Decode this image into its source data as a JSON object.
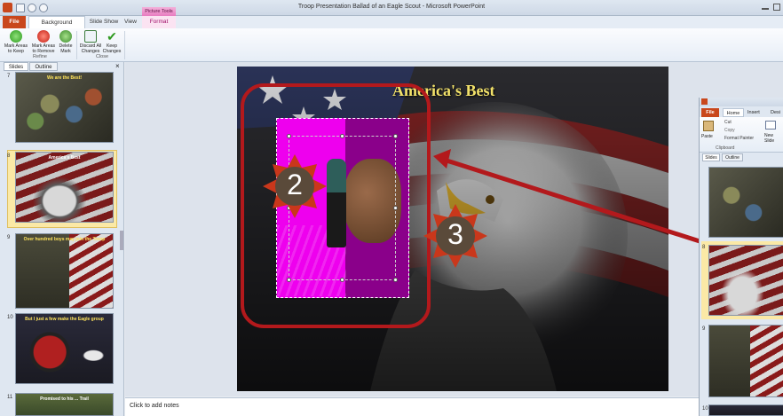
{
  "window": {
    "title": "Troop Presentation Ballad of an Eagle Scout - Microsoft PowerPoint"
  },
  "tabs": {
    "file": "File",
    "background_removal": "Background Removal",
    "slide_show": "Slide Show",
    "view": "View",
    "picture_tools": "Picture Tools",
    "format": "Format"
  },
  "ribbon": {
    "mark_keep": "Mark Areas to Keep",
    "mark_remove": "Mark Areas to Remove",
    "delete_mark": "Delete Mark",
    "discard": "Discard All Changes",
    "keep": "Keep Changes",
    "refine_group": "Refine",
    "close_group": "Close"
  },
  "panel": {
    "slides_tab": "Slides",
    "outline_tab": "Outline",
    "close": "×"
  },
  "slides": [
    {
      "num": "7",
      "title": "We are the Best!"
    },
    {
      "num": "8",
      "title": "America's Best"
    },
    {
      "num": "9",
      "title": "Over hundred boys may join the Troop"
    },
    {
      "num": "10",
      "title": "But I just a few make the Eagle group"
    },
    {
      "num": "11",
      "title": "Promised to his ... Trail"
    }
  ],
  "slide": {
    "title": "America's Best"
  },
  "callouts": {
    "two": "2",
    "three": "3"
  },
  "notes": {
    "placeholder": "Click to add notes"
  },
  "second_window": {
    "tabs": {
      "file": "File",
      "home": "Home",
      "insert": "Insert",
      "design": "Desi"
    },
    "clipboard": {
      "paste": "Paste",
      "cut": "Cut",
      "copy": "Copy",
      "format_painter": "Format Painter",
      "group": "Clipboard"
    },
    "new_slide": "New Slide",
    "slides_tab": "Slides",
    "outline_tab": "Outline",
    "slide_nums": [
      "8",
      "9",
      "10"
    ]
  },
  "colors": {
    "accent": "#c9471c",
    "magenta": "#e000e0",
    "callout_red": "#b3191c",
    "callout_fill": "#5a4a3a",
    "callout_star": "#c9371b"
  }
}
